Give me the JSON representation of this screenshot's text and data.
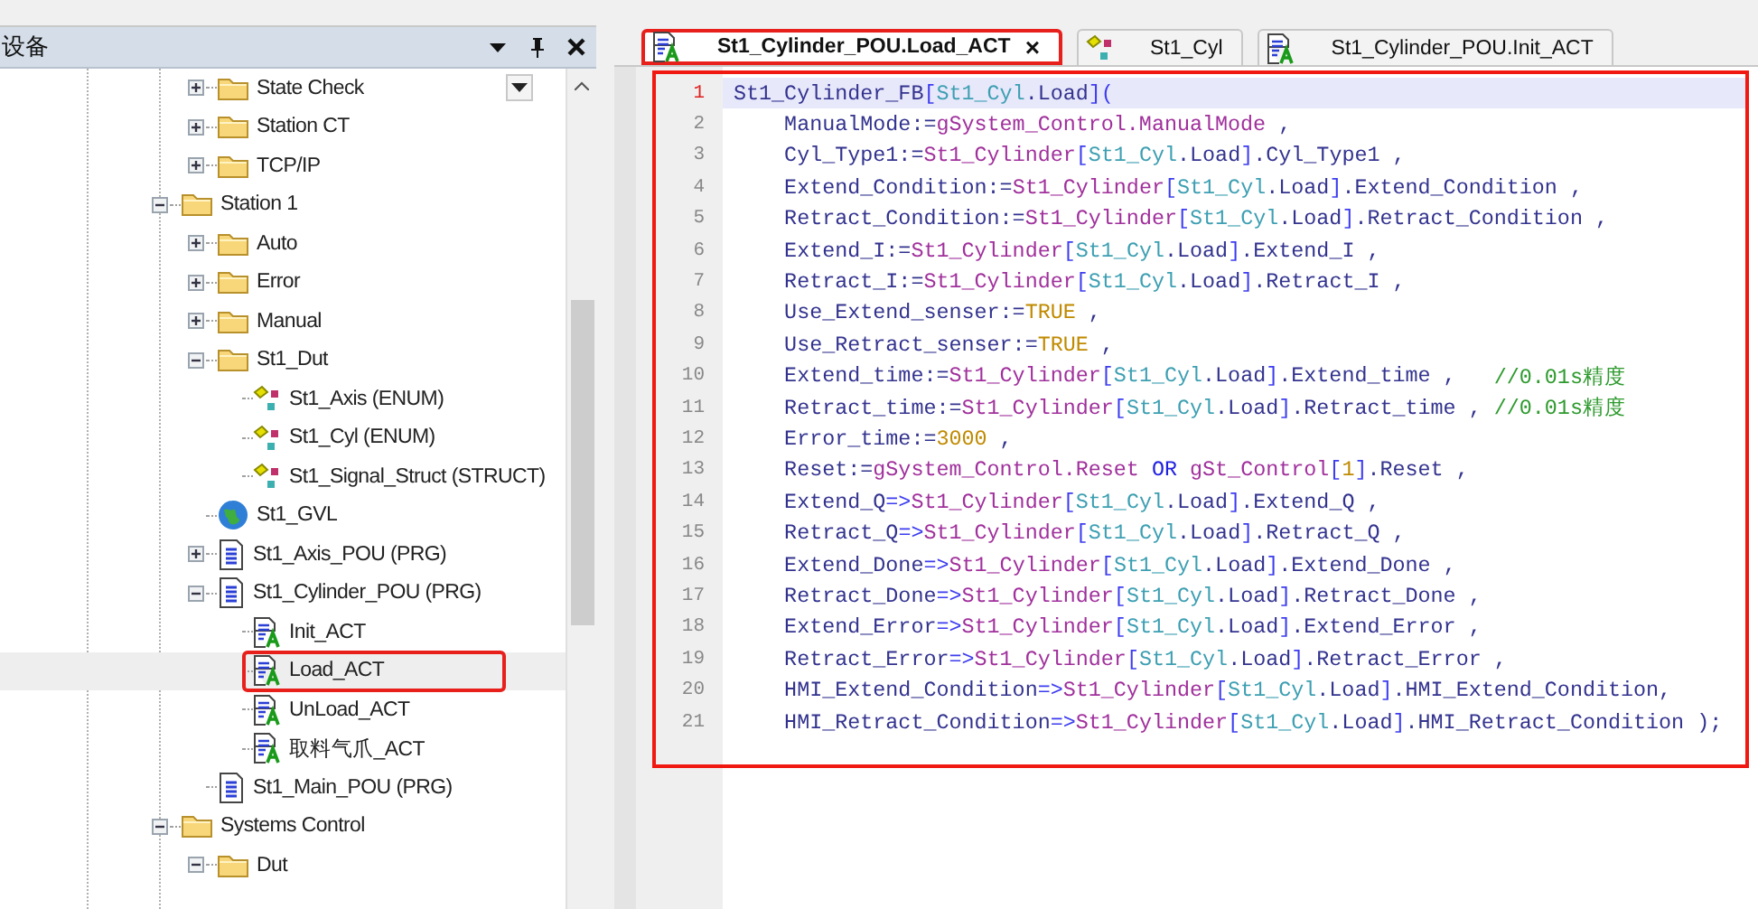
{
  "devices_panel": {
    "title": "设备",
    "tree": [
      {
        "kind": "continuation",
        "children": [
          {
            "label": "State Check",
            "kind": "folder",
            "expanded": false,
            "selected": false
          },
          {
            "label": "Station CT",
            "kind": "folder",
            "expanded": false,
            "selected": false
          },
          {
            "label": "TCP/IP",
            "kind": "folder",
            "expanded": false,
            "selected": false
          }
        ]
      },
      {
        "label": "Station 1",
        "kind": "folder",
        "expanded": true,
        "selected": false,
        "children": [
          {
            "label": "Auto",
            "kind": "folder",
            "expanded": false,
            "selected": false
          },
          {
            "label": "Error",
            "kind": "folder",
            "expanded": false,
            "selected": false
          },
          {
            "label": "Manual",
            "kind": "folder",
            "expanded": false,
            "selected": false
          },
          {
            "label": "St1_Dut",
            "kind": "folder",
            "expanded": true,
            "selected": false,
            "children": [
              {
                "label": "St1_Axis (ENUM)",
                "kind": "dut",
                "selected": false
              },
              {
                "label": "St1_Cyl (ENUM)",
                "kind": "dut",
                "selected": false
              },
              {
                "label": "St1_Signal_Struct (STRUCT)",
                "kind": "dut",
                "selected": false
              }
            ]
          },
          {
            "label": "St1_GVL",
            "kind": "gvl",
            "selected": false
          },
          {
            "label": "St1_Axis_POU (PRG)",
            "kind": "pou",
            "expanded": false,
            "selected": false
          },
          {
            "label": "St1_Cylinder_POU (PRG)",
            "kind": "pou",
            "expanded": true,
            "selected": false,
            "children": [
              {
                "label": "Init_ACT",
                "kind": "action",
                "selected": false
              },
              {
                "label": "Load_ACT",
                "kind": "action",
                "selected": true,
                "marked": true
              },
              {
                "label": "UnLoad_ACT",
                "kind": "action",
                "selected": false
              },
              {
                "label": "取料气爪_ACT",
                "kind": "action",
                "selected": false
              }
            ]
          },
          {
            "label": "St1_Main_POU (PRG)",
            "kind": "pou",
            "selected": false
          }
        ]
      },
      {
        "label": "Systems Control",
        "kind": "folder",
        "expanded": true,
        "selected": false,
        "children": [
          {
            "label": "Dut",
            "kind": "folder",
            "expanded": true,
            "selected": false
          }
        ]
      }
    ]
  },
  "editor": {
    "tabs": [
      {
        "label": "St1_Cylinder_POU.Load_ACT",
        "kind": "action",
        "selected": true,
        "marked": true,
        "close": "×"
      },
      {
        "label": "St1_Cyl",
        "kind": "dut",
        "selected": false
      },
      {
        "label": "St1_Cylinder_POU.Init_ACT",
        "kind": "action",
        "selected": false
      }
    ],
    "marked": true,
    "lines": [
      {
        "number": "1",
        "current": true,
        "tokens": [
          {
            "text": "St1_Cylinder_FB",
            "kind": "id"
          },
          {
            "text": "[",
            "kind": "op"
          },
          {
            "text": "St1_Cyl",
            "kind": "en"
          },
          {
            "text": ".Load",
            "kind": "id"
          },
          {
            "text": "](",
            "kind": "op"
          }
        ]
      },
      {
        "number": "2",
        "current": false,
        "tokens": [
          {
            "text": "    ManualMode:=",
            "kind": "id"
          },
          {
            "text": "gSystem_Control.ManualMode",
            "kind": "gv"
          },
          {
            "text": " ,",
            "kind": "id"
          }
        ]
      },
      {
        "number": "3",
        "current": false,
        "tokens": [
          {
            "text": "    Cyl_Type1:=",
            "kind": "id"
          },
          {
            "text": "St1_Cylinder",
            "kind": "gv"
          },
          {
            "text": "[",
            "kind": "op"
          },
          {
            "text": "St1_Cyl",
            "kind": "en"
          },
          {
            "text": ".Load",
            "kind": "id"
          },
          {
            "text": "]",
            "kind": "op"
          },
          {
            "text": ".Cyl_Type1 ,",
            "kind": "id"
          }
        ]
      },
      {
        "number": "4",
        "current": false,
        "tokens": [
          {
            "text": "    Extend_Condition:=",
            "kind": "id"
          },
          {
            "text": "St1_Cylinder",
            "kind": "gv"
          },
          {
            "text": "[",
            "kind": "op"
          },
          {
            "text": "St1_Cyl",
            "kind": "en"
          },
          {
            "text": ".Load",
            "kind": "id"
          },
          {
            "text": "]",
            "kind": "op"
          },
          {
            "text": ".Extend_Condition ,",
            "kind": "id"
          }
        ]
      },
      {
        "number": "5",
        "current": false,
        "tokens": [
          {
            "text": "    Retract_Condition:=",
            "kind": "id"
          },
          {
            "text": "St1_Cylinder",
            "kind": "gv"
          },
          {
            "text": "[",
            "kind": "op"
          },
          {
            "text": "St1_Cyl",
            "kind": "en"
          },
          {
            "text": ".Load",
            "kind": "id"
          },
          {
            "text": "]",
            "kind": "op"
          },
          {
            "text": ".Retract_Condition ,",
            "kind": "id"
          }
        ]
      },
      {
        "number": "6",
        "current": false,
        "tokens": [
          {
            "text": "    Extend_I:=",
            "kind": "id"
          },
          {
            "text": "St1_Cylinder",
            "kind": "gv"
          },
          {
            "text": "[",
            "kind": "op"
          },
          {
            "text": "St1_Cyl",
            "kind": "en"
          },
          {
            "text": ".Load",
            "kind": "id"
          },
          {
            "text": "]",
            "kind": "op"
          },
          {
            "text": ".Extend_I ,",
            "kind": "id"
          }
        ]
      },
      {
        "number": "7",
        "current": false,
        "tokens": [
          {
            "text": "    Retract_I:=",
            "kind": "id"
          },
          {
            "text": "St1_Cylinder",
            "kind": "gv"
          },
          {
            "text": "[",
            "kind": "op"
          },
          {
            "text": "St1_Cyl",
            "kind": "en"
          },
          {
            "text": ".Load",
            "kind": "id"
          },
          {
            "text": "]",
            "kind": "op"
          },
          {
            "text": ".Retract_I ,",
            "kind": "id"
          }
        ]
      },
      {
        "number": "8",
        "current": false,
        "tokens": [
          {
            "text": "    Use_Extend_senser:=",
            "kind": "id"
          },
          {
            "text": "TRUE",
            "kind": "lit"
          },
          {
            "text": " ,",
            "kind": "id"
          }
        ]
      },
      {
        "number": "9",
        "current": false,
        "tokens": [
          {
            "text": "    Use_Retract_senser:=",
            "kind": "id"
          },
          {
            "text": "TRUE",
            "kind": "lit"
          },
          {
            "text": " ,",
            "kind": "id"
          }
        ]
      },
      {
        "number": "10",
        "current": false,
        "tokens": [
          {
            "text": "    Extend_time:=",
            "kind": "id"
          },
          {
            "text": "St1_Cylinder",
            "kind": "gv"
          },
          {
            "text": "[",
            "kind": "op"
          },
          {
            "text": "St1_Cyl",
            "kind": "en"
          },
          {
            "text": ".Load",
            "kind": "id"
          },
          {
            "text": "]",
            "kind": "op"
          },
          {
            "text": ".Extend_time ,   ",
            "kind": "id"
          },
          {
            "text": "//0.01s精度",
            "kind": "cm"
          }
        ]
      },
      {
        "number": "11",
        "current": false,
        "tokens": [
          {
            "text": "    Retract_time:=",
            "kind": "id"
          },
          {
            "text": "St1_Cylinder",
            "kind": "gv"
          },
          {
            "text": "[",
            "kind": "op"
          },
          {
            "text": "St1_Cyl",
            "kind": "en"
          },
          {
            "text": ".Load",
            "kind": "id"
          },
          {
            "text": "]",
            "kind": "op"
          },
          {
            "text": ".Retract_time , ",
            "kind": "id"
          },
          {
            "text": "//0.01s精度",
            "kind": "cm"
          }
        ]
      },
      {
        "number": "12",
        "current": false,
        "tokens": [
          {
            "text": "    Error_time:=",
            "kind": "id"
          },
          {
            "text": "3000",
            "kind": "lit"
          },
          {
            "text": " ,",
            "kind": "id"
          }
        ]
      },
      {
        "number": "13",
        "current": false,
        "tokens": [
          {
            "text": "    Reset:=",
            "kind": "id"
          },
          {
            "text": "gSystem_Control.Reset",
            "kind": "gv"
          },
          {
            "text": " OR ",
            "kind": "kw"
          },
          {
            "text": "gSt_Control",
            "kind": "gv"
          },
          {
            "text": "[",
            "kind": "op"
          },
          {
            "text": "1",
            "kind": "lit"
          },
          {
            "text": "]",
            "kind": "op"
          },
          {
            "text": ".Reset ,",
            "kind": "id"
          }
        ]
      },
      {
        "number": "14",
        "current": false,
        "tokens": [
          {
            "text": "    Extend_Q",
            "kind": "id"
          },
          {
            "text": "=>",
            "kind": "op"
          },
          {
            "text": "St1_Cylinder",
            "kind": "gv"
          },
          {
            "text": "[",
            "kind": "op"
          },
          {
            "text": "St1_Cyl",
            "kind": "en"
          },
          {
            "text": ".Load",
            "kind": "id"
          },
          {
            "text": "]",
            "kind": "op"
          },
          {
            "text": ".Extend_Q ,",
            "kind": "id"
          }
        ]
      },
      {
        "number": "15",
        "current": false,
        "tokens": [
          {
            "text": "    Retract_Q",
            "kind": "id"
          },
          {
            "text": "=>",
            "kind": "op"
          },
          {
            "text": "St1_Cylinder",
            "kind": "gv"
          },
          {
            "text": "[",
            "kind": "op"
          },
          {
            "text": "St1_Cyl",
            "kind": "en"
          },
          {
            "text": ".Load",
            "kind": "id"
          },
          {
            "text": "]",
            "kind": "op"
          },
          {
            "text": ".Retract_Q ,",
            "kind": "id"
          }
        ]
      },
      {
        "number": "16",
        "current": false,
        "tokens": [
          {
            "text": "    Extend_Done",
            "kind": "id"
          },
          {
            "text": "=>",
            "kind": "op"
          },
          {
            "text": "St1_Cylinder",
            "kind": "gv"
          },
          {
            "text": "[",
            "kind": "op"
          },
          {
            "text": "St1_Cyl",
            "kind": "en"
          },
          {
            "text": ".Load",
            "kind": "id"
          },
          {
            "text": "]",
            "kind": "op"
          },
          {
            "text": ".Extend_Done ,",
            "kind": "id"
          }
        ]
      },
      {
        "number": "17",
        "current": false,
        "tokens": [
          {
            "text": "    Retract_Done",
            "kind": "id"
          },
          {
            "text": "=>",
            "kind": "op"
          },
          {
            "text": "St1_Cylinder",
            "kind": "gv"
          },
          {
            "text": "[",
            "kind": "op"
          },
          {
            "text": "St1_Cyl",
            "kind": "en"
          },
          {
            "text": ".Load",
            "kind": "id"
          },
          {
            "text": "]",
            "kind": "op"
          },
          {
            "text": ".Retract_Done ,",
            "kind": "id"
          }
        ]
      },
      {
        "number": "18",
        "current": false,
        "tokens": [
          {
            "text": "    Extend_Error",
            "kind": "id"
          },
          {
            "text": "=>",
            "kind": "op"
          },
          {
            "text": "St1_Cylinder",
            "kind": "gv"
          },
          {
            "text": "[",
            "kind": "op"
          },
          {
            "text": "St1_Cyl",
            "kind": "en"
          },
          {
            "text": ".Load",
            "kind": "id"
          },
          {
            "text": "]",
            "kind": "op"
          },
          {
            "text": ".Extend_Error ,",
            "kind": "id"
          }
        ]
      },
      {
        "number": "19",
        "current": false,
        "tokens": [
          {
            "text": "    Retract_Error",
            "kind": "id"
          },
          {
            "text": "=>",
            "kind": "op"
          },
          {
            "text": "St1_Cylinder",
            "kind": "gv"
          },
          {
            "text": "[",
            "kind": "op"
          },
          {
            "text": "St1_Cyl",
            "kind": "en"
          },
          {
            "text": ".Load",
            "kind": "id"
          },
          {
            "text": "]",
            "kind": "op"
          },
          {
            "text": ".Retract_Error ,",
            "kind": "id"
          }
        ]
      },
      {
        "number": "20",
        "current": false,
        "tokens": [
          {
            "text": "    HMI_Extend_Condition",
            "kind": "id"
          },
          {
            "text": "=>",
            "kind": "op"
          },
          {
            "text": "St1_Cylinder",
            "kind": "gv"
          },
          {
            "text": "[",
            "kind": "op"
          },
          {
            "text": "St1_Cyl",
            "kind": "en"
          },
          {
            "text": ".Load",
            "kind": "id"
          },
          {
            "text": "]",
            "kind": "op"
          },
          {
            "text": ".HMI_Extend_Condition,",
            "kind": "id"
          }
        ]
      },
      {
        "number": "21",
        "current": false,
        "tokens": [
          {
            "text": "    HMI_Retract_Condition",
            "kind": "id"
          },
          {
            "text": "=>",
            "kind": "op"
          },
          {
            "text": "St1_Cylinder",
            "kind": "gv"
          },
          {
            "text": "[",
            "kind": "op"
          },
          {
            "text": "St1_Cyl",
            "kind": "en"
          },
          {
            "text": ".Load",
            "kind": "id"
          },
          {
            "text": "]",
            "kind": "op"
          },
          {
            "text": ".HMI_Retract_Condition );",
            "kind": "id"
          }
        ]
      }
    ]
  }
}
